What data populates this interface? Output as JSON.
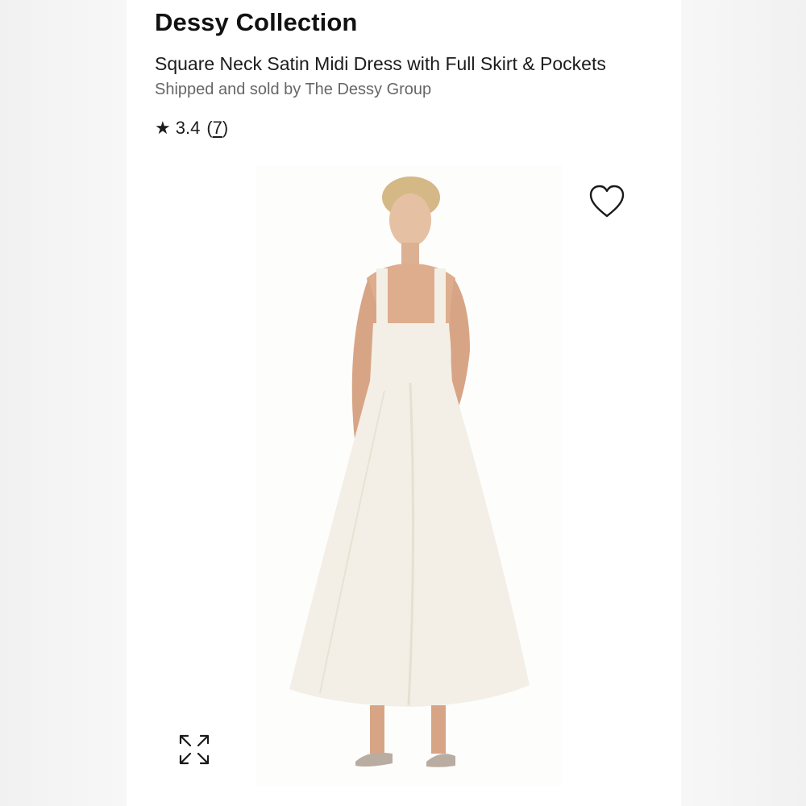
{
  "product": {
    "brand": "Dessy Collection",
    "name": "Square Neck Satin Midi Dress with Full Skirt & Pockets",
    "seller": "Shipped and sold by The Dessy Group",
    "rating": {
      "star_glyph": "★",
      "value": "3.4",
      "open_paren": "(",
      "count": "7",
      "close_paren": ")"
    }
  },
  "image": {
    "alt": "Model wearing ivory square neck satin midi dress"
  },
  "icons": {
    "wishlist": "heart-outline-icon",
    "expand": "expand-arrows-icon"
  },
  "colors": {
    "dress": "#f3efe6",
    "skin": "#d9a98a",
    "hair": "#d4b886",
    "text_primary": "#111111",
    "text_secondary": "#666666"
  }
}
